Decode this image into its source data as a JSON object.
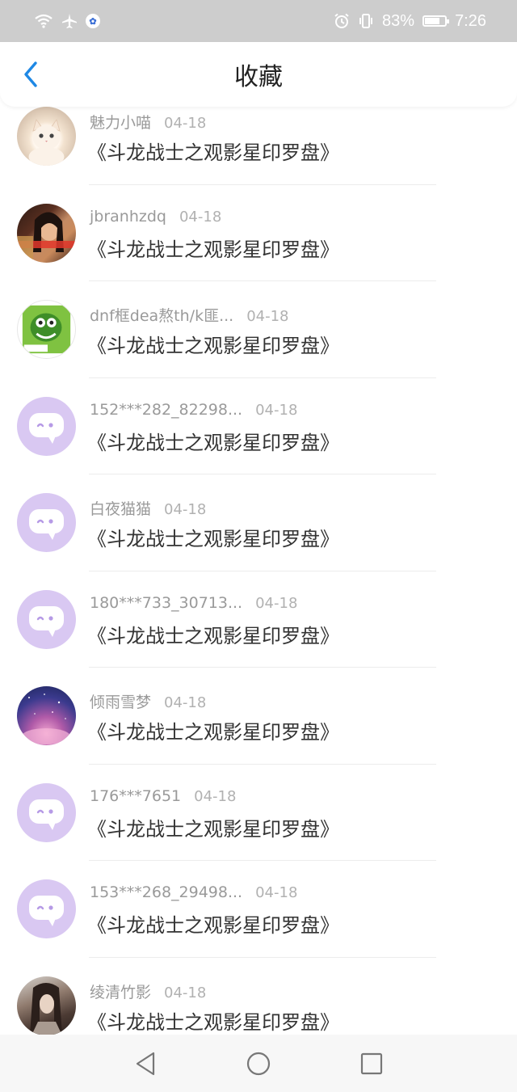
{
  "status_bar": {
    "battery_percent": "83%",
    "time": "7:26",
    "battery_level": 0.83,
    "icons": [
      "wifi-icon",
      "airplane-icon",
      "baidu-icon",
      "alarm-icon",
      "vibrate-icon",
      "battery-icon"
    ]
  },
  "header": {
    "title": "收藏",
    "back_icon": "chevron-left-icon",
    "accent_color": "#1e88e5"
  },
  "favorites": [
    {
      "name": "魅力小喵",
      "date": "04-18",
      "title": "《斗龙战士之观影星印罗盘》",
      "avatar": "cat-photo"
    },
    {
      "name": "jbranhzdq",
      "date": "04-18",
      "title": "《斗龙战士之观影星印罗盘》",
      "avatar": "girl-photo"
    },
    {
      "name": "dnf框dea熬th/k匪...",
      "date": "04-18",
      "title": "《斗龙战士之观影星印罗盘》",
      "avatar": "green-cartoon"
    },
    {
      "name": "152***282_82298...",
      "date": "04-18",
      "title": "《斗龙战士之观影星印罗盘》",
      "avatar": "default-chat"
    },
    {
      "name": "白夜猫猫",
      "date": "04-18",
      "title": "《斗龙战士之观影星印罗盘》",
      "avatar": "default-chat"
    },
    {
      "name": "180***733_30713...",
      "date": "04-18",
      "title": "《斗龙战士之观影星印罗盘》",
      "avatar": "default-chat"
    },
    {
      "name": "倾雨雪梦",
      "date": "04-18",
      "title": "《斗龙战士之观影星印罗盘》",
      "avatar": "galaxy"
    },
    {
      "name": "176***7651",
      "date": "04-18",
      "title": "《斗龙战士之观影星印罗盘》",
      "avatar": "default-chat"
    },
    {
      "name": "153***268_29498...",
      "date": "04-18",
      "title": "《斗龙战士之观影星印罗盘》",
      "avatar": "default-chat"
    },
    {
      "name": "绫清竹影",
      "date": "04-18",
      "title": "《斗龙战士之观影星印罗盘》",
      "avatar": "ink-portrait"
    }
  ],
  "system_nav": {
    "icons": [
      "back-triangle-icon",
      "home-circle-icon",
      "recents-square-icon"
    ]
  }
}
